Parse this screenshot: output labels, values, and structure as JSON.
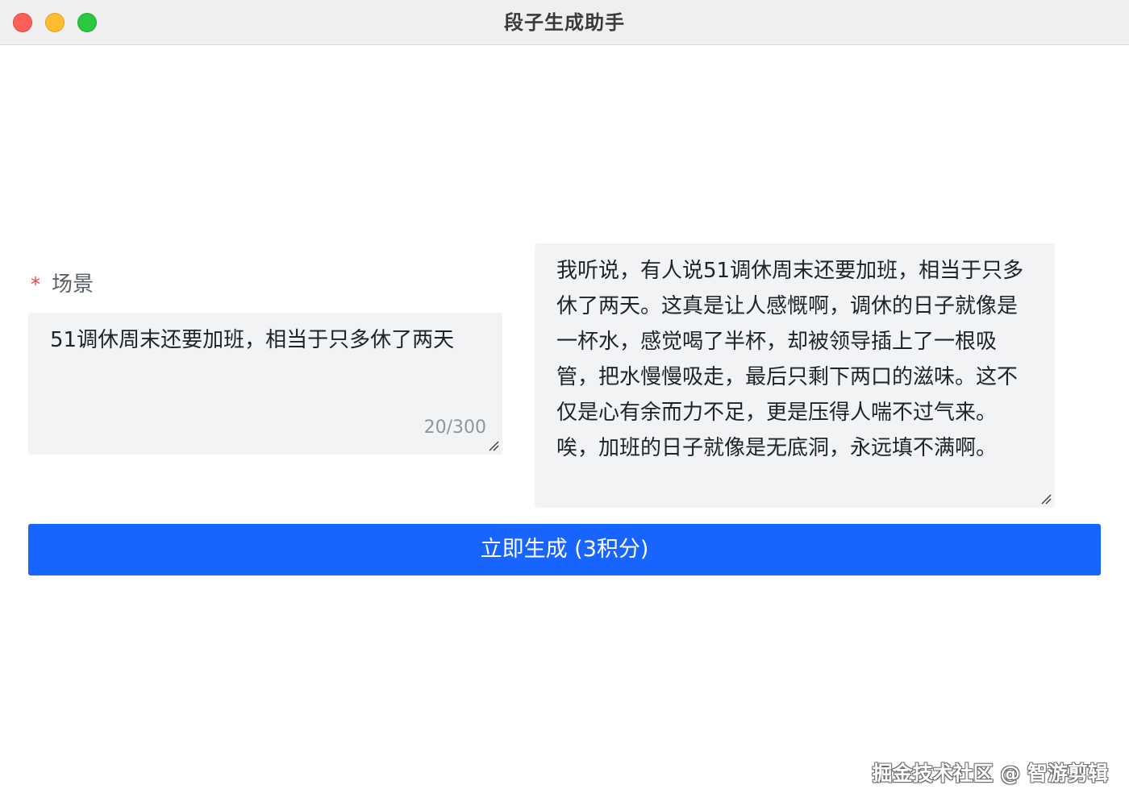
{
  "window": {
    "title": "段子生成助手"
  },
  "form": {
    "scene_label": "场景",
    "required_mark": "*",
    "scene_value": "51调休周末还要加班，相当于只多休了两天",
    "char_count": "20/300"
  },
  "result": {
    "text": "我听说，有人说51调休周末还要加班，相当于只多休了两天。这真是让人感慨啊，调休的日子就像是一杯水，感觉喝了半杯，却被领导插上了一根吸管，把水慢慢吸走，最后只剩下两口的滋味。这不仅是心有余而力不足，更是压得人喘不过气来。唉，加班的日子就像是无底洞，永远填不满啊。"
  },
  "actions": {
    "generate_label": "立即生成 (3积分)"
  },
  "watermark": {
    "text": "掘金技术社区 @ 智游剪辑"
  },
  "colors": {
    "primary": "#1764ff",
    "required": "#f04343",
    "input_bg": "#f2f3f5",
    "titlebar_bg": "#efefef"
  },
  "icons": {
    "close": "traffic-light-close",
    "minimize": "traffic-light-minimize",
    "zoom": "traffic-light-zoom",
    "resize": "resize-handle-icon"
  }
}
